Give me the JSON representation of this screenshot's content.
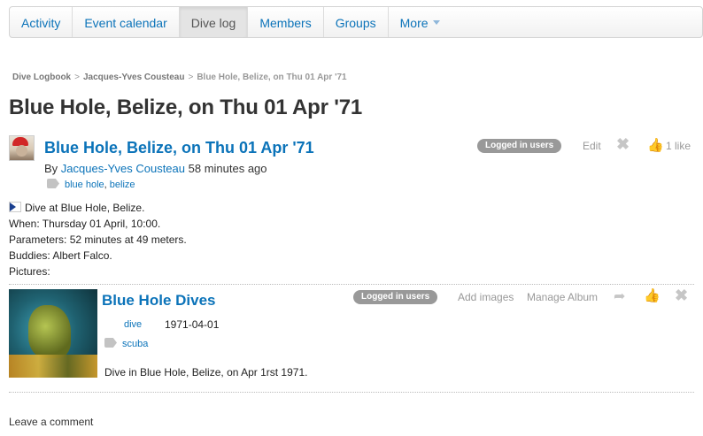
{
  "nav": {
    "items": [
      {
        "label": "Activity"
      },
      {
        "label": "Event calendar"
      },
      {
        "label": "Dive log"
      },
      {
        "label": "Members"
      },
      {
        "label": "Groups"
      },
      {
        "label": "More"
      }
    ],
    "active_index": 2
  },
  "breadcrumb": {
    "root": "Dive Logbook",
    "owner": "Jacques-Yves Cousteau",
    "current": "Blue Hole, Belize, on Thu 01 Apr '71",
    "separator": ">"
  },
  "page_title": "Blue Hole, Belize, on Thu 01 Apr '71",
  "post": {
    "title": "Blue Hole, Belize, on Thu 01 Apr '71",
    "by_prefix": "By",
    "author": "Jacques-Yves Cousteau",
    "time": "58 minutes ago",
    "tags": [
      "blue hole",
      "belize"
    ],
    "tag_separator": ",",
    "access_badge": "Logged in users",
    "edit_label": "Edit",
    "likes_label": "1 like",
    "summary": "Dive at Blue Hole, Belize.",
    "when": "When: Thursday 01 April, 10:00.",
    "parameters": "Parameters: 52 minutes at 49 meters.",
    "buddies": "Buddies: Albert Falco.",
    "pictures": "Pictures:"
  },
  "album": {
    "title": "Blue Hole Dives",
    "access_badge": "Logged in users",
    "add_images_label": "Add images",
    "manage_label": "Manage Album",
    "category": "dive",
    "date": "1971-04-01",
    "tags": [
      "scuba"
    ],
    "description": "Dive in Blue Hole, Belize, on Apr 1rst 1971."
  },
  "comment_label": "Leave a comment",
  "colors": {
    "link": "#0b73b9",
    "badge": "#999999",
    "nav_active": "#e4e4e4"
  }
}
